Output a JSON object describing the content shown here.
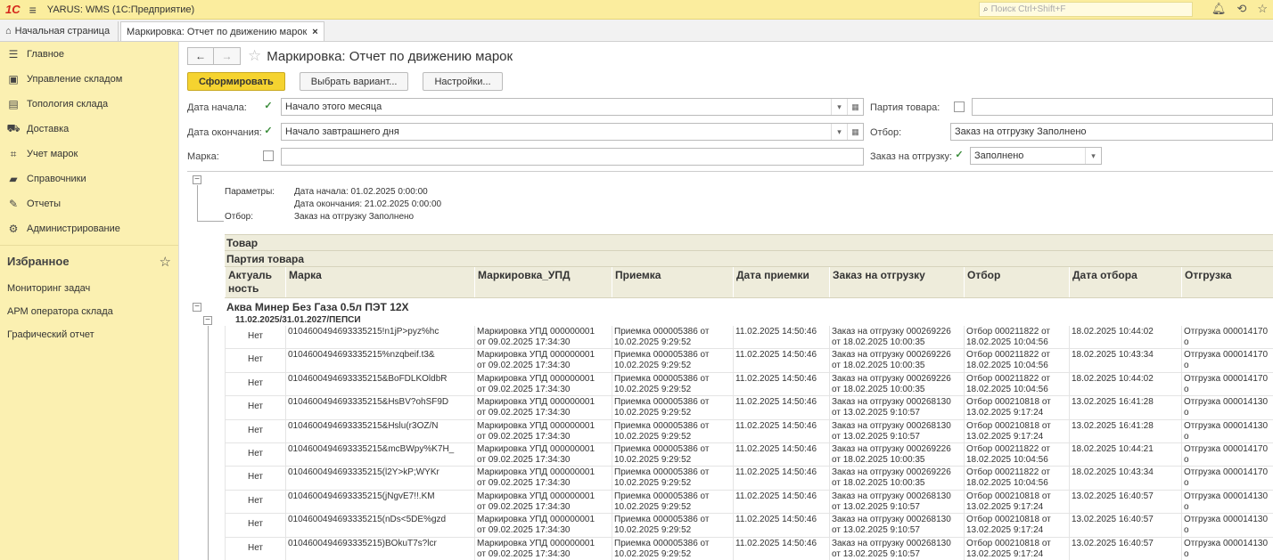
{
  "titlebar": {
    "logo": "1С",
    "title": "YARUS: WMS  (1С:Предприятие)",
    "search_placeholder": "Поиск Ctrl+Shift+F"
  },
  "tabs": {
    "home": "Начальная страница",
    "active": "Маркировка: Отчет по движению марок"
  },
  "sidebar": {
    "items": [
      {
        "label": "Главное",
        "icon": "menu-icon"
      },
      {
        "label": "Управление складом",
        "icon": "warehouse-icon"
      },
      {
        "label": "Топология склада",
        "icon": "topology-icon"
      },
      {
        "label": "Доставка",
        "icon": "truck-icon"
      },
      {
        "label": "Учет марок",
        "icon": "scan-icon"
      },
      {
        "label": "Справочники",
        "icon": "book-icon"
      },
      {
        "label": "Отчеты",
        "icon": "report-icon"
      },
      {
        "label": "Администрирование",
        "icon": "gear-icon"
      }
    ],
    "favorites_title": "Избранное",
    "favorites": [
      "Мониторинг задач",
      "АРМ оператора склада",
      "Графический отчет"
    ]
  },
  "page": {
    "title": "Маркировка: Отчет по движению марок",
    "btn_form": "Сформировать",
    "btn_variant": "Выбрать вариант...",
    "btn_settings": "Настройки..."
  },
  "filters": {
    "date_start_label": "Дата начала:",
    "date_start_value": "Начало этого месяца",
    "date_end_label": "Дата окончания:",
    "date_end_value": "Начало завтрашнего дня",
    "mark_label": "Марка:",
    "mark_value": "",
    "batch_label": "Партия товара:",
    "batch_value": "",
    "selection_label": "Отбор:",
    "selection_value": "Заказ на отгрузку Заполнено",
    "order_label": "Заказ на отгрузку:",
    "order_value": "Заполнено"
  },
  "report": {
    "params_label": "Параметры:",
    "param_start": "Дата начала: 01.02.2025 0:00:00",
    "param_end": "Дата окончания: 21.02.2025 0:00:00",
    "selection_label": "Отбор:",
    "selection_value": "Заказ на отгрузку Заполнено",
    "hdr_product": "Товар",
    "hdr_batch": "Партия товара",
    "columns": [
      "Актуаль\nность",
      "Марка",
      "Маркировка_УПД",
      "Приемка",
      "Дата приемки",
      "Заказ на отгрузку",
      "Отбор",
      "Дата отбора",
      "Отгрузка"
    ],
    "group": "Аква Минер Без Газа 0.5л ПЭТ 12Х",
    "subgroup": "11.02.2025/31.01.2027/ПЕПСИ",
    "rows": [
      [
        "Нет",
        "0104600494693335215!n1jP>pyz%hc",
        "Маркировка УПД 000000001\nот 09.02.2025 17:34:30",
        "Приемка 000005386 от\n10.02.2025 9:29:52",
        "11.02.2025 14:50:46",
        "Заказ на отгрузку 000269226\nот 18.02.2025 10:00:35",
        "Отбор 000211822 от\n18.02.2025 10:04:56",
        "18.02.2025 10:44:02",
        "Отгрузка 000014170 о"
      ],
      [
        "Нет",
        "0104600494693335215%nzqbeif.t3&",
        "Маркировка УПД 000000001\nот 09.02.2025 17:34:30",
        "Приемка 000005386 от\n10.02.2025 9:29:52",
        "11.02.2025 14:50:46",
        "Заказ на отгрузку 000269226\nот 18.02.2025 10:00:35",
        "Отбор 000211822 от\n18.02.2025 10:04:56",
        "18.02.2025 10:43:34",
        "Отгрузка 000014170 о"
      ],
      [
        "Нет",
        "0104600494693335215&BoFDLKOldbR",
        "Маркировка УПД 000000001\nот 09.02.2025 17:34:30",
        "Приемка 000005386 от\n10.02.2025 9:29:52",
        "11.02.2025 14:50:46",
        "Заказ на отгрузку 000269226\nот 18.02.2025 10:00:35",
        "Отбор 000211822 от\n18.02.2025 10:04:56",
        "18.02.2025 10:44:02",
        "Отгрузка 000014170 о"
      ],
      [
        "Нет",
        "0104600494693335215&HsBV?ohSF9D",
        "Маркировка УПД 000000001\nот 09.02.2025 17:34:30",
        "Приемка 000005386 от\n10.02.2025 9:29:52",
        "11.02.2025 14:50:46",
        "Заказ на отгрузку 000268130\nот 13.02.2025 9:10:57",
        "Отбор 000210818 от\n13.02.2025 9:17:24",
        "13.02.2025 16:41:28",
        "Отгрузка 000014130 о"
      ],
      [
        "Нет",
        "0104600494693335215&Hslu(r3OZ/N",
        "Маркировка УПД 000000001\nот 09.02.2025 17:34:30",
        "Приемка 000005386 от\n10.02.2025 9:29:52",
        "11.02.2025 14:50:46",
        "Заказ на отгрузку 000268130\nот 13.02.2025 9:10:57",
        "Отбор 000210818 от\n13.02.2025 9:17:24",
        "13.02.2025 16:41:28",
        "Отгрузка 000014130 о"
      ],
      [
        "Нет",
        "0104600494693335215&mcBWpy%K7H_",
        "Маркировка УПД 000000001\nот 09.02.2025 17:34:30",
        "Приемка 000005386 от\n10.02.2025 9:29:52",
        "11.02.2025 14:50:46",
        "Заказ на отгрузку 000269226\nот 18.02.2025 10:00:35",
        "Отбор 000211822 от\n18.02.2025 10:04:56",
        "18.02.2025 10:44:21",
        "Отгрузка 000014170 о"
      ],
      [
        "Нет",
        "0104600494693335215(l2Y>kP;WYKr",
        "Маркировка УПД 000000001\nот 09.02.2025 17:34:30",
        "Приемка 000005386 от\n10.02.2025 9:29:52",
        "11.02.2025 14:50:46",
        "Заказ на отгрузку 000269226\nот 18.02.2025 10:00:35",
        "Отбор 000211822 от\n18.02.2025 10:04:56",
        "18.02.2025 10:43:34",
        "Отгрузка 000014170 о"
      ],
      [
        "Нет",
        "0104600494693335215(jNgvE7!!.KM",
        "Маркировка УПД 000000001\nот 09.02.2025 17:34:30",
        "Приемка 000005386 от\n10.02.2025 9:29:52",
        "11.02.2025 14:50:46",
        "Заказ на отгрузку 000268130\nот 13.02.2025 9:10:57",
        "Отбор 000210818 от\n13.02.2025 9:17:24",
        "13.02.2025 16:40:57",
        "Отгрузка 000014130 о"
      ],
      [
        "Нет",
        "0104600494693335215(nDs<5DE%gzd",
        "Маркировка УПД 000000001\nот 09.02.2025 17:34:30",
        "Приемка 000005386 от\n10.02.2025 9:29:52",
        "11.02.2025 14:50:46",
        "Заказ на отгрузку 000268130\nот 13.02.2025 9:10:57",
        "Отбор 000210818 от\n13.02.2025 9:17:24",
        "13.02.2025 16:40:57",
        "Отгрузка 000014130 о"
      ],
      [
        "Нет",
        "0104600494693335215)BOkuT7s?lcr",
        "Маркировка УПД 000000001\nот 09.02.2025 17:34:30",
        "Приемка 000005386 от\n10.02.2025 9:29:52",
        "11.02.2025 14:50:46",
        "Заказ на отгрузку 000268130\nот 13.02.2025 9:10:57",
        "Отбор 000210818 от\n13.02.2025 9:17:24",
        "13.02.2025 16:40:57",
        "Отгрузка 000014130 о"
      ]
    ]
  }
}
